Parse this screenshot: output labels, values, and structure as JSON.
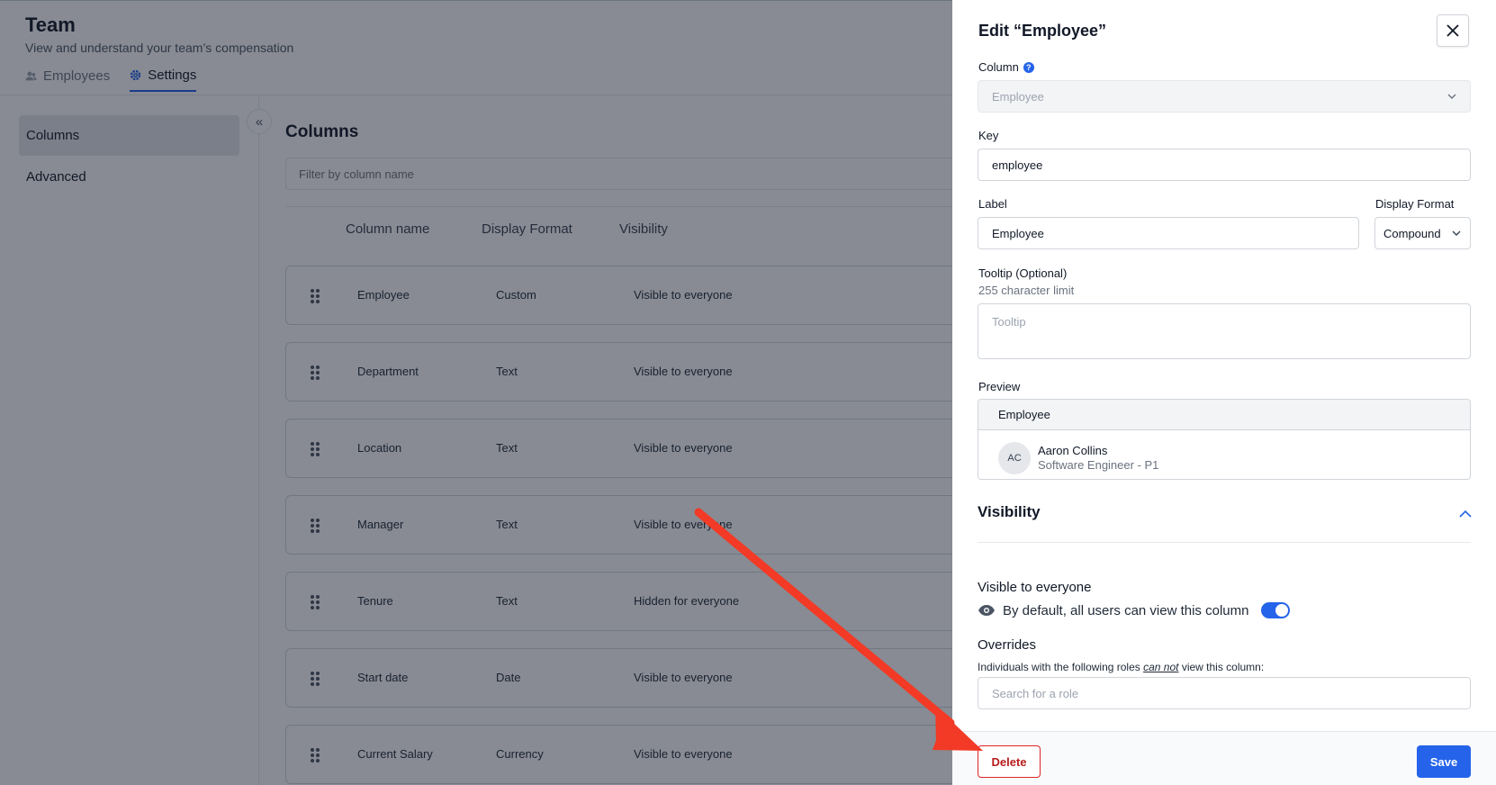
{
  "header": {
    "title": "Team",
    "subtitle": "View and understand your team’s compensation"
  },
  "tabs": [
    {
      "label": "Employees",
      "icon": "users-icon",
      "active": false
    },
    {
      "label": "Settings",
      "icon": "gear-icon",
      "active": true
    }
  ],
  "sidebar": {
    "items": [
      {
        "label": "Columns",
        "active": true
      },
      {
        "label": "Advanced",
        "active": false
      }
    ]
  },
  "main": {
    "title": "Columns",
    "filter_placeholder": "Filter by column name",
    "columns": [
      "Column name",
      "Display Format",
      "Visibility"
    ],
    "rows": [
      {
        "name": "Employee",
        "format": "Custom",
        "visibility": "Visible to everyone"
      },
      {
        "name": "Department",
        "format": "Text",
        "visibility": "Visible to everyone"
      },
      {
        "name": "Location",
        "format": "Text",
        "visibility": "Visible to everyone"
      },
      {
        "name": "Manager",
        "format": "Text",
        "visibility": "Visible to everyone"
      },
      {
        "name": "Tenure",
        "format": "Text",
        "visibility": "Hidden for everyone"
      },
      {
        "name": "Start date",
        "format": "Date",
        "visibility": "Visible to everyone"
      },
      {
        "name": "Current Salary",
        "format": "Currency",
        "visibility": "Visible to everyone"
      }
    ]
  },
  "drawer": {
    "title": "Edit “Employee”",
    "column_label": "Column",
    "column_value": "Employee",
    "key_label": "Key",
    "key_value": "employee",
    "label_label": "Label",
    "label_value": "Employee",
    "display_format_label": "Display Format",
    "display_format_value": "Compound",
    "tooltip_label": "Tooltip (Optional)",
    "tooltip_hint": "255 character limit",
    "tooltip_placeholder": "Tooltip",
    "preview_label": "Preview",
    "preview_header": "Employee",
    "preview_initials": "AC",
    "preview_name": "Aaron Collins",
    "preview_role": "Software Engineer - P1",
    "visibility_heading": "Visibility",
    "visible_title": "Visible to everyone",
    "visible_desc": "By default, all users can view this column",
    "visible_toggle": true,
    "overrides_title": "Overrides",
    "overrides_desc_pre": "Individuals with the following roles ",
    "overrides_desc_em": "can not",
    "overrides_desc_post": " view this column:",
    "role_search_placeholder": "Search for a role",
    "delete_label": "Delete",
    "save_label": "Save"
  },
  "colors": {
    "accent": "#2563eb",
    "danger": "#dc2626",
    "arrow": "#f23a26"
  }
}
